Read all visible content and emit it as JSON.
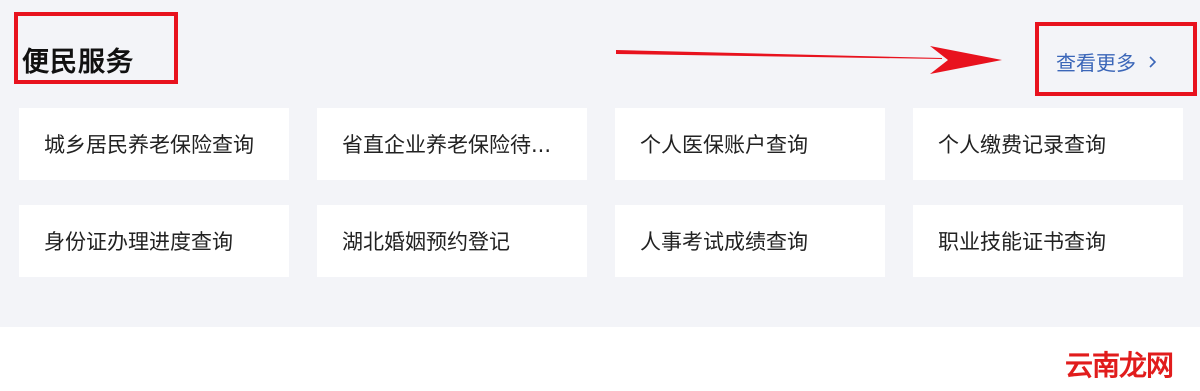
{
  "section": {
    "title": "便民服务",
    "more_label": "查看更多",
    "more_icon": "chevron-right-icon"
  },
  "services": [
    {
      "label": "城乡居民养老保险查询"
    },
    {
      "label": "省直企业养老保险待..."
    },
    {
      "label": "个人医保账户查询"
    },
    {
      "label": "个人缴费记录查询"
    },
    {
      "label": "身份证办理进度查询"
    },
    {
      "label": "湖北婚姻预约登记"
    },
    {
      "label": "人事考试成绩查询"
    },
    {
      "label": "职业技能证书查询"
    }
  ],
  "watermark": "云南龙网",
  "colors": {
    "panel_bg": "#f3f4f8",
    "link": "#3b66b8",
    "annotation_red": "#e8121e"
  }
}
